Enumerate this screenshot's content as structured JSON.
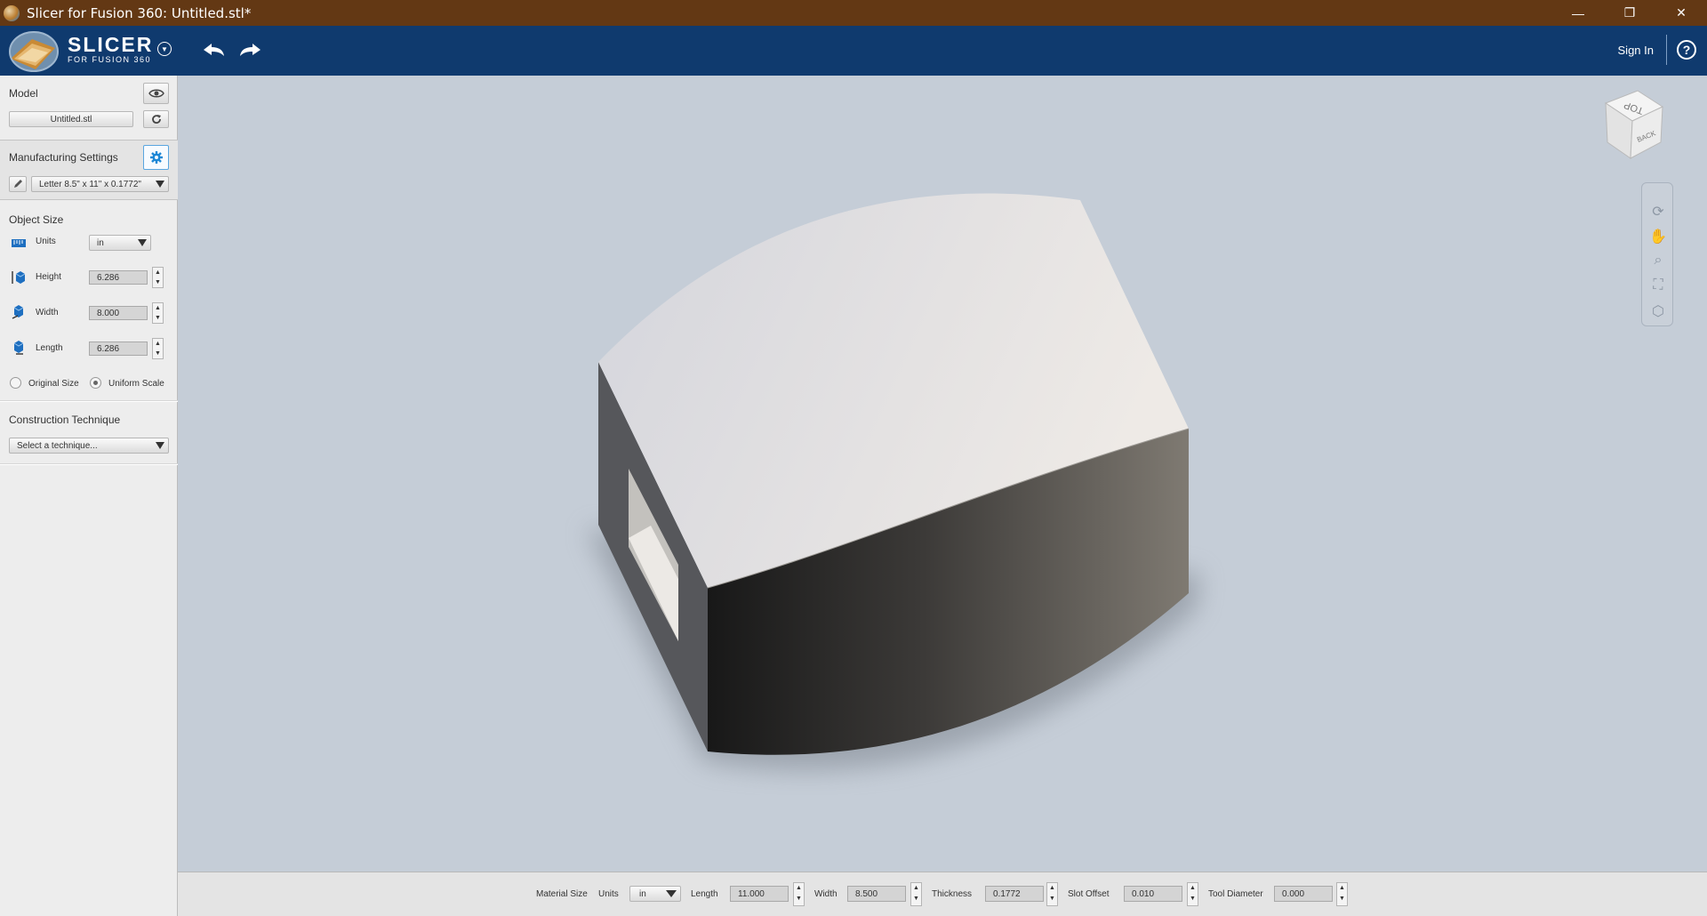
{
  "window": {
    "title": "Slicer for Fusion 360: Untitled.stl*",
    "minimize": "—",
    "maximize": "❐",
    "close": "✕"
  },
  "header": {
    "logo_main": "SLICER",
    "logo_sub": "FOR FUSION 360",
    "sign_in": "Sign In",
    "help": "?"
  },
  "model": {
    "title": "Model",
    "file_button": "Untitled.stl"
  },
  "manufacturing": {
    "title": "Manufacturing Settings",
    "preset": "Letter 8.5\" x 11\" x 0.1772\""
  },
  "object_size": {
    "title": "Object Size",
    "units_label": "Units",
    "units_value": "in",
    "height_label": "Height",
    "height_value": "6.286",
    "width_label": "Width",
    "width_value": "8.000",
    "length_label": "Length",
    "length_value": "6.286",
    "original_size": "Original Size",
    "uniform_scale": "Uniform Scale"
  },
  "construction": {
    "title": "Construction Technique",
    "placeholder": "Select a technique..."
  },
  "viewcube": {
    "top": "TOP",
    "back": "BACK"
  },
  "material": {
    "label": "Material Size",
    "units_label": "Units",
    "units_value": "in",
    "length_label": "Length",
    "length_value": "11.000",
    "width_label": "Width",
    "width_value": "8.500",
    "thickness_label": "Thickness",
    "thickness_value": "0.1772",
    "slot_offset_label": "Slot Offset",
    "slot_offset_value": "0.010",
    "tool_diameter_label": "Tool Diameter",
    "tool_diameter_value": "0.000"
  },
  "colors": {
    "titlebar": "#633814",
    "header": "#0f3a6e",
    "viewport": "#c5cdd7",
    "accent": "#1e88d6"
  }
}
